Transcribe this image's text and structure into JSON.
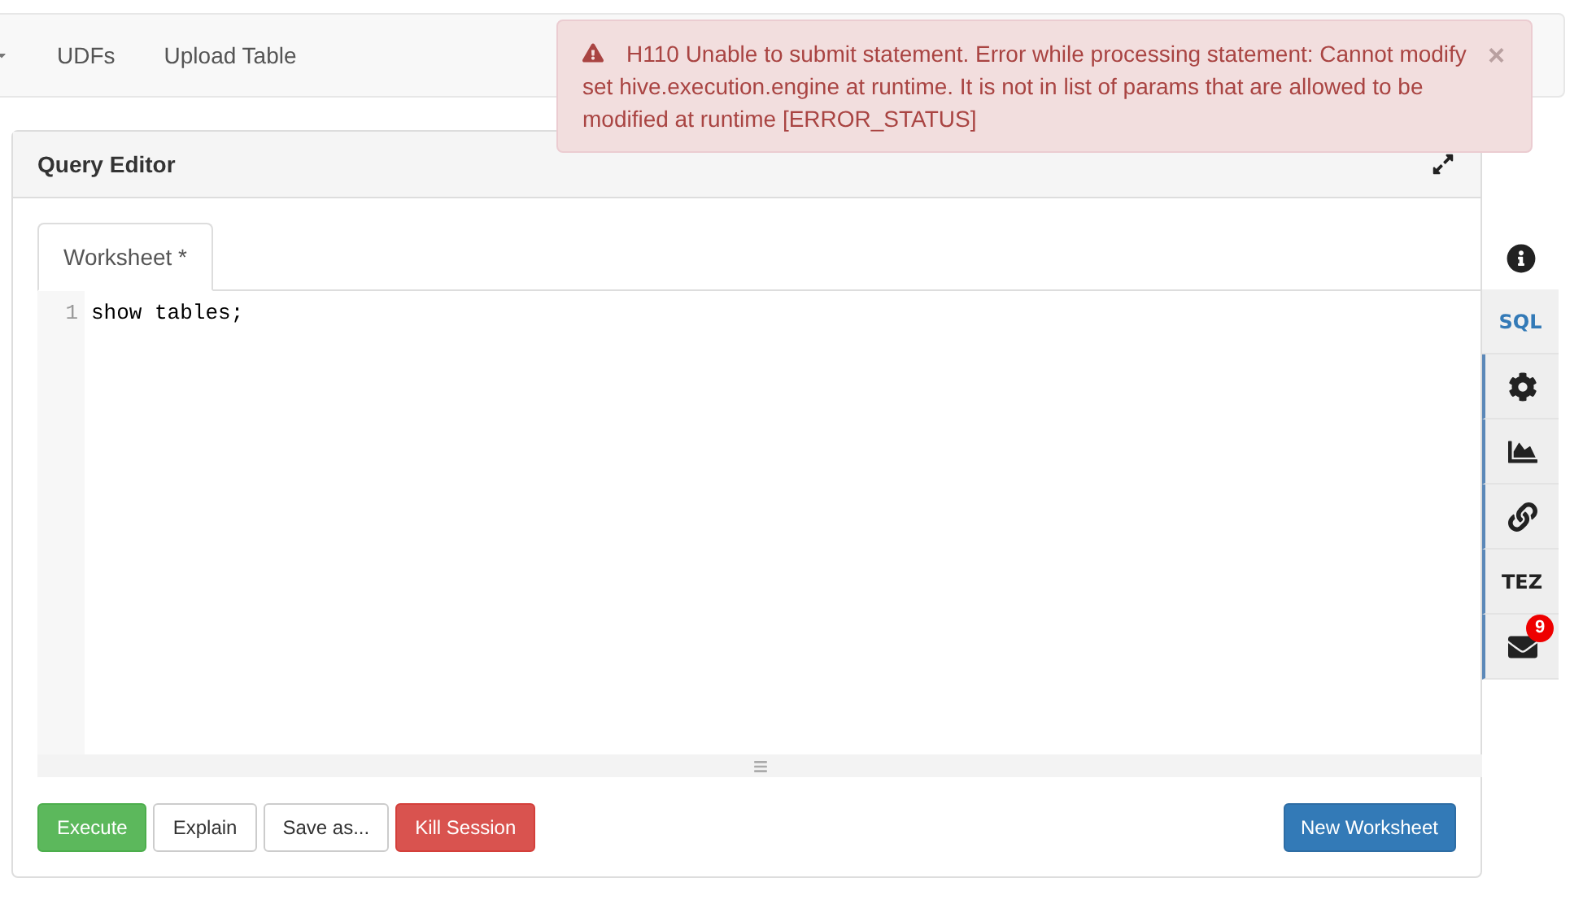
{
  "nav": {
    "items": [
      {
        "label": "UDFs"
      },
      {
        "label": "Upload Table"
      }
    ]
  },
  "alert": {
    "message": "H110 Unable to submit statement. Error while processing statement: Cannot modify set hive.execution.engine at runtime. It is not in list of params that are allowed to be modified at runtime [ERROR_STATUS]",
    "close": "×"
  },
  "panel": {
    "title": "Query Editor"
  },
  "tabs": [
    {
      "label": "Worksheet *",
      "selected": true
    }
  ],
  "editor": {
    "lines": [
      {
        "number": "1",
        "code": "show tables;"
      }
    ]
  },
  "buttons": [
    {
      "label": "Execute",
      "kind": "success"
    },
    {
      "label": "Explain",
      "kind": "default"
    },
    {
      "label": "Save as...",
      "kind": "default"
    },
    {
      "label": "Kill Session",
      "kind": "danger"
    },
    {
      "label": "New Worksheet",
      "kind": "primary"
    }
  ],
  "side_toolbar": [
    {
      "kind": "info",
      "selected": false
    },
    {
      "kind": "text",
      "label": "SQL",
      "selected": true
    },
    {
      "kind": "settings",
      "selected": false
    },
    {
      "kind": "chart",
      "selected": false
    },
    {
      "kind": "link",
      "selected": false
    },
    {
      "kind": "text",
      "label": "TEZ",
      "selected": false
    },
    {
      "kind": "mail",
      "badge": "9",
      "selected": false
    }
  ]
}
